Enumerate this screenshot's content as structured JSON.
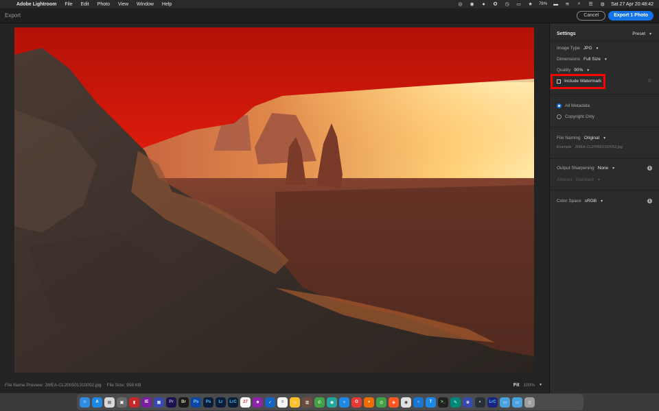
{
  "menubar": {
    "app_name": "Adobe Lightroom",
    "menus": [
      "File",
      "Edit",
      "Photo",
      "View",
      "Window",
      "Help"
    ],
    "battery": "76%",
    "clock": "Sat 27 Apr  20:48:42"
  },
  "titlebar": {
    "title": "Export",
    "cancel_label": "Cancel",
    "export_label": "Export 1 Photo"
  },
  "status": {
    "filename_preview": "File Name Preview: JWEA-CL200501310052.jpg",
    "file_size": "File Size: 958 KB",
    "zoom_fit": "Fit",
    "zoom_percent": "100%"
  },
  "settings": {
    "heading": "Settings",
    "preset_label": "Preset",
    "image_type_label": "Image Type",
    "image_type_value": "JPG",
    "dimensions_label": "Dimensions",
    "dimensions_value": "Full Size",
    "quality_label": "Quality",
    "quality_value": "90%",
    "watermark_label": "Include Watermark",
    "watermark_checked": false,
    "metadata_all": "All Metadata",
    "metadata_copyright": "Copyright Only",
    "metadata_selected": "All Metadata",
    "file_naming_label": "File Naming",
    "file_naming_value": "Original",
    "example_label": "Example",
    "example_value": "JWEA-CL200501310052.jpg",
    "sharpening_label": "Output Sharpening",
    "sharpening_value": "None",
    "amount_label": "Amount",
    "amount_value": "Standard",
    "color_space_label": "Color Space",
    "color_space_value": "sRGB"
  },
  "colors": {
    "accent": "#1473e6",
    "highlight_box": "#ff0000"
  }
}
